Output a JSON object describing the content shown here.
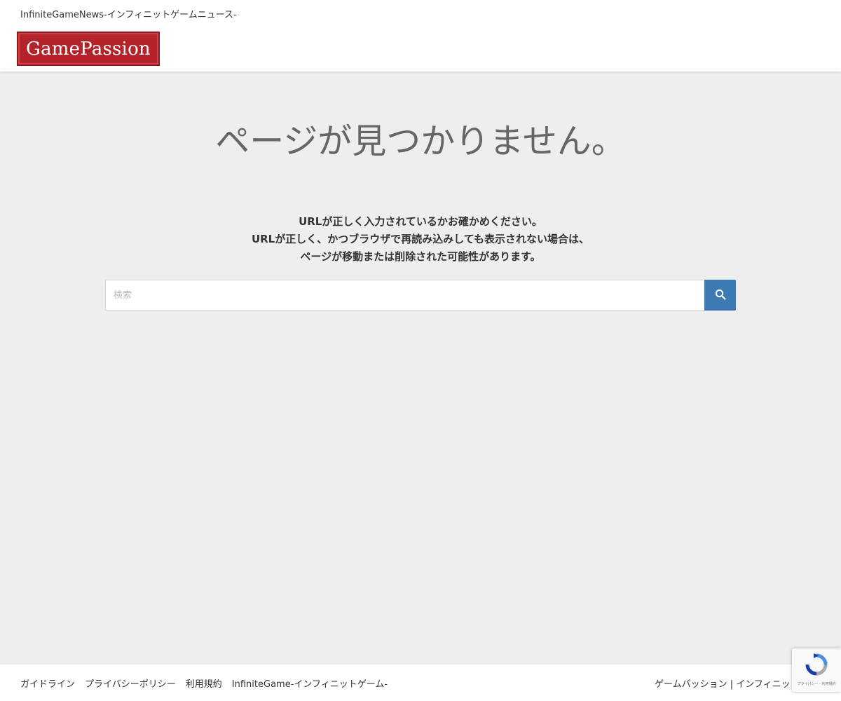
{
  "header": {
    "tagline": "InfiniteGameNews-インフィニットゲームニュース-",
    "logo_text": "GamePassion"
  },
  "main": {
    "title": "ページが見つかりません。",
    "message": [
      "URLが正しく入力されているかお確かめください。",
      "URLが正しく、かつブラウザで再読み込みしても表示されない場合は、",
      "ページが移動または削除された可能性があります。"
    ],
    "search": {
      "placeholder": "検索"
    }
  },
  "footer": {
    "links": [
      "ガイドライン",
      "プライバシーポリシー",
      "利用規約",
      "InfiniteGame-インフィニットゲーム-"
    ],
    "right_text": "ゲームパッション | インフィニットゲーム"
  },
  "recaptcha": {
    "text": "プライバシー・利用規約"
  },
  "colors": {
    "logo_bg": "#b4232a",
    "search_button": "#3d79b2",
    "page_bg": "#eeeeee"
  }
}
